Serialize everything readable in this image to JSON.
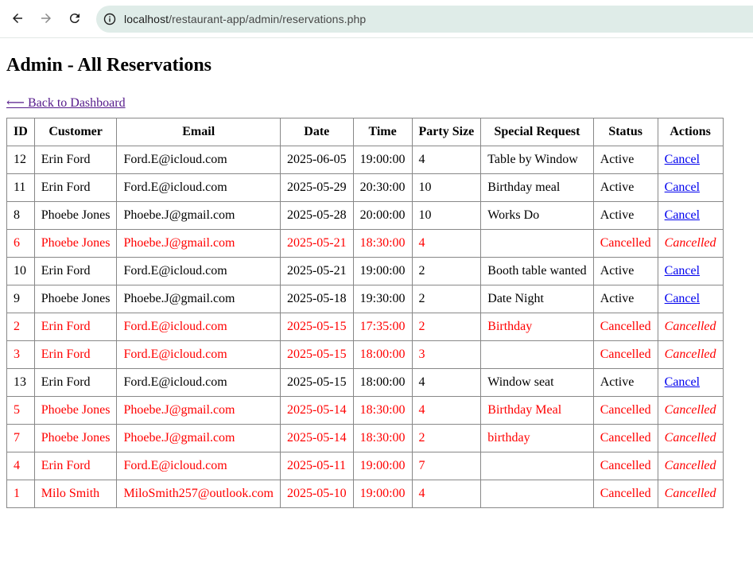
{
  "browser": {
    "url_host": "localhost",
    "url_path": "/restaurant-app/admin/reservations.php"
  },
  "page": {
    "title": "Admin - All Reservations",
    "back_link": "⟵ Back to Dashboard"
  },
  "table": {
    "headers": [
      "ID",
      "Customer",
      "Email",
      "Date",
      "Time",
      "Party Size",
      "Special Request",
      "Status",
      "Actions"
    ],
    "rows": [
      {
        "id": "12",
        "customer": "Erin Ford",
        "email": "Ford.E@icloud.com",
        "date": "2025-06-05",
        "time": "19:00:00",
        "party": "4",
        "request": "Table by Window",
        "status": "Active",
        "action": "Cancel",
        "cancelled": false
      },
      {
        "id": "11",
        "customer": "Erin Ford",
        "email": "Ford.E@icloud.com",
        "date": "2025-05-29",
        "time": "20:30:00",
        "party": "10",
        "request": "Birthday meal",
        "status": "Active",
        "action": "Cancel",
        "cancelled": false
      },
      {
        "id": "8",
        "customer": "Phoebe Jones",
        "email": "Phoebe.J@gmail.com",
        "date": "2025-05-28",
        "time": "20:00:00",
        "party": "10",
        "request": "Works Do",
        "status": "Active",
        "action": "Cancel",
        "cancelled": false
      },
      {
        "id": "6",
        "customer": "Phoebe Jones",
        "email": "Phoebe.J@gmail.com",
        "date": "2025-05-21",
        "time": "18:30:00",
        "party": "4",
        "request": "",
        "status": "Cancelled",
        "action": "Cancelled",
        "cancelled": true
      },
      {
        "id": "10",
        "customer": "Erin Ford",
        "email": "Ford.E@icloud.com",
        "date": "2025-05-21",
        "time": "19:00:00",
        "party": "2",
        "request": "Booth table wanted",
        "status": "Active",
        "action": "Cancel",
        "cancelled": false
      },
      {
        "id": "9",
        "customer": "Phoebe Jones",
        "email": "Phoebe.J@gmail.com",
        "date": "2025-05-18",
        "time": "19:30:00",
        "party": "2",
        "request": "Date Night",
        "status": "Active",
        "action": "Cancel",
        "cancelled": false
      },
      {
        "id": "2",
        "customer": "Erin Ford",
        "email": "Ford.E@icloud.com",
        "date": "2025-05-15",
        "time": "17:35:00",
        "party": "2",
        "request": "Birthday",
        "status": "Cancelled",
        "action": "Cancelled",
        "cancelled": true
      },
      {
        "id": "3",
        "customer": "Erin Ford",
        "email": "Ford.E@icloud.com",
        "date": "2025-05-15",
        "time": "18:00:00",
        "party": "3",
        "request": "",
        "status": "Cancelled",
        "action": "Cancelled",
        "cancelled": true
      },
      {
        "id": "13",
        "customer": "Erin Ford",
        "email": "Ford.E@icloud.com",
        "date": "2025-05-15",
        "time": "18:00:00",
        "party": "4",
        "request": "Window seat",
        "status": "Active",
        "action": "Cancel",
        "cancelled": false
      },
      {
        "id": "5",
        "customer": "Phoebe Jones",
        "email": "Phoebe.J@gmail.com",
        "date": "2025-05-14",
        "time": "18:30:00",
        "party": "4",
        "request": "Birthday Meal",
        "status": "Cancelled",
        "action": "Cancelled",
        "cancelled": true
      },
      {
        "id": "7",
        "customer": "Phoebe Jones",
        "email": "Phoebe.J@gmail.com",
        "date": "2025-05-14",
        "time": "18:30:00",
        "party": "2",
        "request": "birthday",
        "status": "Cancelled",
        "action": "Cancelled",
        "cancelled": true
      },
      {
        "id": "4",
        "customer": "Erin Ford",
        "email": "Ford.E@icloud.com",
        "date": "2025-05-11",
        "time": "19:00:00",
        "party": "7",
        "request": "",
        "status": "Cancelled",
        "action": "Cancelled",
        "cancelled": true
      },
      {
        "id": "1",
        "customer": "Milo Smith",
        "email": "MiloSmith257@outlook.com",
        "date": "2025-05-10",
        "time": "19:00:00",
        "party": "4",
        "request": "",
        "status": "Cancelled",
        "action": "Cancelled",
        "cancelled": true
      }
    ]
  },
  "colors": {
    "cancelled_text": "#ff0000",
    "link": "#0000ee",
    "visited_link": "#551a8b",
    "url_bar_bg": "#dfece8"
  }
}
